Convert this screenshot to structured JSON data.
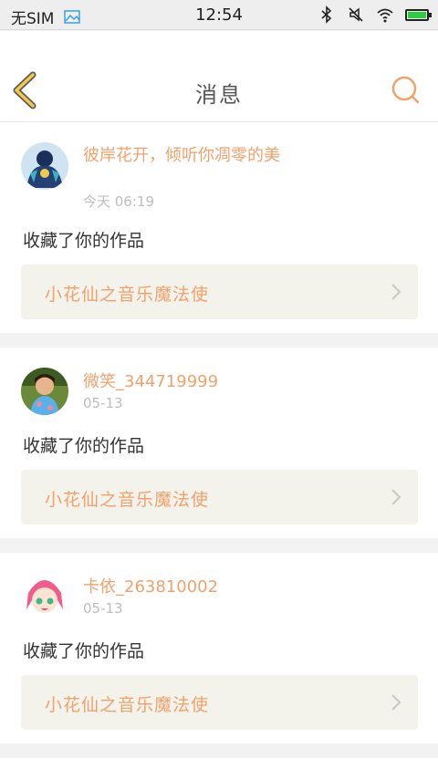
{
  "status_bar": {
    "carrier": "无SIM",
    "time": "12:54",
    "icons": [
      "image-icon",
      "bluetooth-icon",
      "mute-icon",
      "wifi-icon",
      "battery-icon"
    ]
  },
  "header": {
    "title": "消息",
    "back_icon": "chevron-left-icon",
    "search_icon": "search-icon"
  },
  "colors": {
    "accent": "#f0a26d",
    "back_arrow": "#f5c84a",
    "card_bg": "#ffffff",
    "page_bg": "#f2f2f2",
    "work_bg": "#f3f2eb",
    "muted_text": "#bdbdbd"
  },
  "messages": [
    {
      "user_name": "彼岸花开，倾听你凋零的美",
      "time": "今天 06:19",
      "action": "收藏了你的作品",
      "work_title": "小花仙之音乐魔法使"
    },
    {
      "user_name": "微笑_344719999",
      "time": "05-13",
      "action": "收藏了你的作品",
      "work_title": "小花仙之音乐魔法使"
    },
    {
      "user_name": "卡依_263810002",
      "time": "05-13",
      "action": "收藏了你的作品",
      "work_title": "小花仙之音乐魔法使"
    }
  ]
}
